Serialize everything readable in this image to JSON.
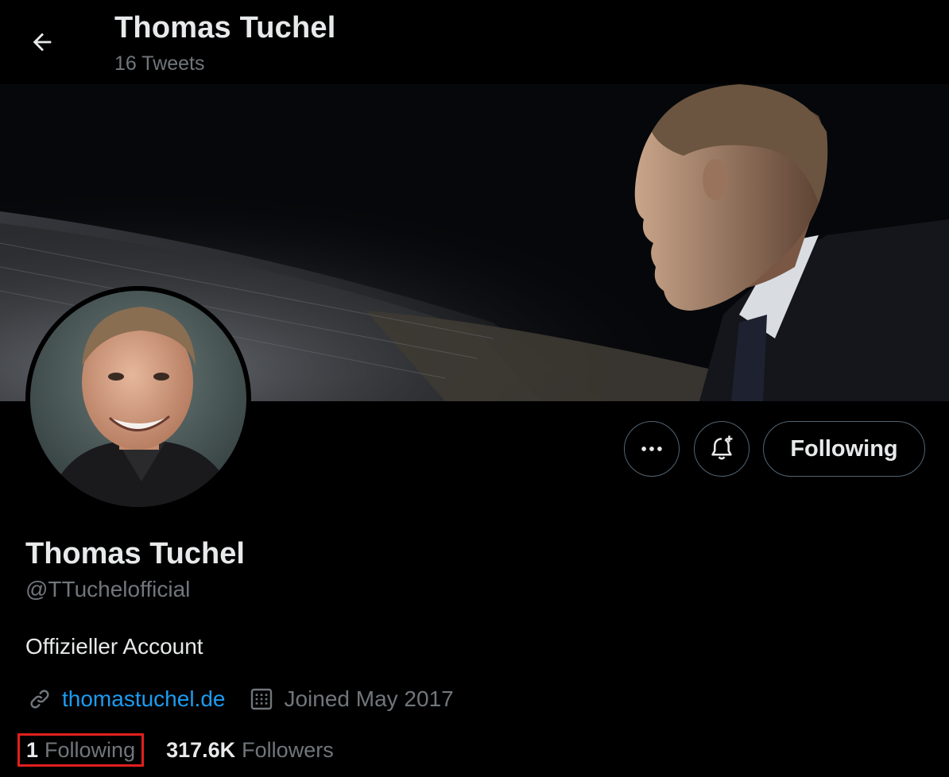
{
  "header": {
    "title": "Thomas Tuchel",
    "subtitle": "16 Tweets",
    "back_icon": "arrow-left-icon"
  },
  "profile": {
    "name": "Thomas Tuchel",
    "handle": "@TTuchelofficial",
    "bio": "Offizieller Account",
    "website": "thomastuchel.de",
    "joined": "Joined May 2017"
  },
  "actions": {
    "more_icon": "more-horizontal-icon",
    "notify_icon": "bell-plus-icon",
    "following_label": "Following"
  },
  "stats": {
    "following_count": "1",
    "following_label": "Following",
    "followers_count": "317.6K",
    "followers_label": "Followers"
  },
  "colors": {
    "background": "#000000",
    "text_primary": "#e7e9ea",
    "text_secondary": "#71767b",
    "link": "#1d9bf0",
    "border": "#536471",
    "highlight": "#e0201e"
  }
}
